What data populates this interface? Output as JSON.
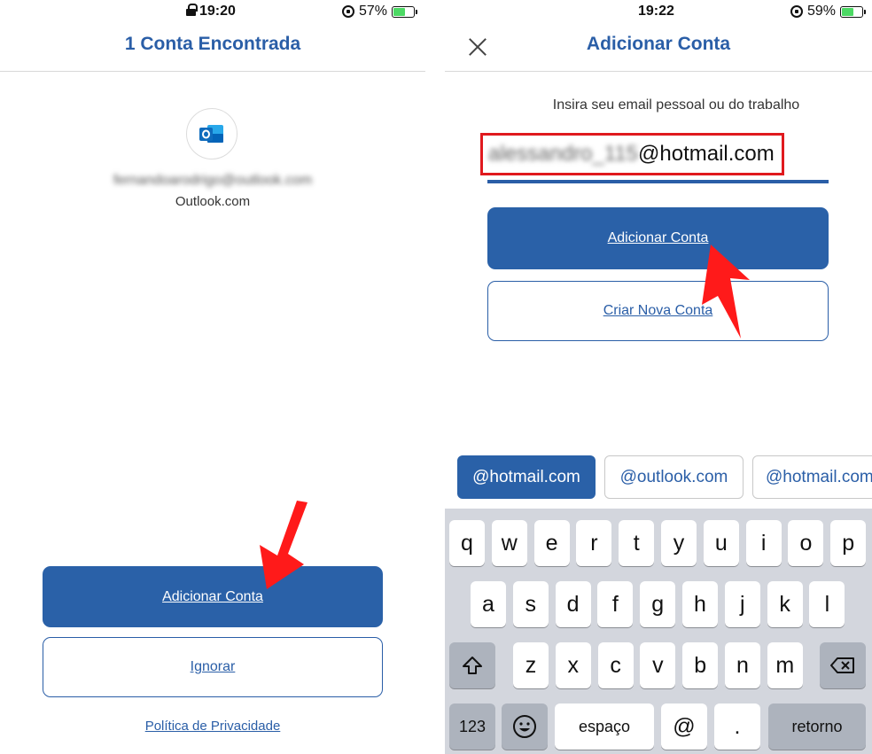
{
  "left": {
    "status": {
      "time": "19:20",
      "battery": "57%",
      "battery_level": 0.57
    },
    "title": "1 Conta Encontrada",
    "account": {
      "email": "fernandoarodrigo@outlook.com",
      "provider": "Outlook.com"
    },
    "add_button": "Adicionar Conta",
    "ignore_button": "Ignorar",
    "privacy_link": "Política de Privacidade"
  },
  "right": {
    "status": {
      "time": "19:22",
      "battery": "59%",
      "battery_level": 0.59
    },
    "title": "Adicionar Conta",
    "prompt": "Insira seu email pessoal ou do trabalho",
    "email": {
      "user": "alessandro_115",
      "domain": "@hotmail.com"
    },
    "add_button": "Adicionar Conta",
    "create_button": "Criar Nova Conta",
    "suggestions": [
      "@hotmail.com",
      "@outlook.com",
      "@hotmail.com"
    ],
    "keyboard": {
      "row1": [
        "q",
        "w",
        "e",
        "r",
        "t",
        "y",
        "u",
        "i",
        "o",
        "p"
      ],
      "row2": [
        "a",
        "s",
        "d",
        "f",
        "g",
        "h",
        "j",
        "k",
        "l"
      ],
      "row3": [
        "z",
        "x",
        "c",
        "v",
        "b",
        "n",
        "m"
      ],
      "numbers": "123",
      "space": "espaço",
      "at": "@",
      "dot": ".",
      "return": "retorno"
    }
  },
  "colors": {
    "brand_blue": "#2a61a8",
    "highlight_red": "#e0191e",
    "arrow_red": "#ff1a1a"
  }
}
